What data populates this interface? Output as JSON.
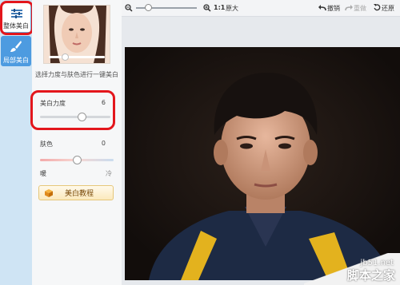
{
  "rail": {
    "tabs": [
      {
        "label": "整体美白",
        "icon": "sliders-icon",
        "active": true
      },
      {
        "label": "局部美白",
        "icon": "brush-icon",
        "active": false
      }
    ]
  },
  "panel": {
    "hint": "选择力度与肤色进行一键美白",
    "strength": {
      "label": "美白力度",
      "value": "6",
      "level": 0.6
    },
    "skin": {
      "label": "肤色",
      "value": "0",
      "level": 0.5
    },
    "warm_label": "暖",
    "cool_label": "冷",
    "tutorial_label": "美白教程"
  },
  "toolbar": {
    "zoom_fit": "1:1",
    "zoom_original": "原大",
    "undo": "撤销",
    "redo": "重做",
    "reset": "还原",
    "zoom_level": 0.2
  },
  "watermark": {
    "site": "jb51.net",
    "name": "脚本之家"
  },
  "colors": {
    "highlight": "#e3161c",
    "active_rail": "#4d9be0"
  }
}
